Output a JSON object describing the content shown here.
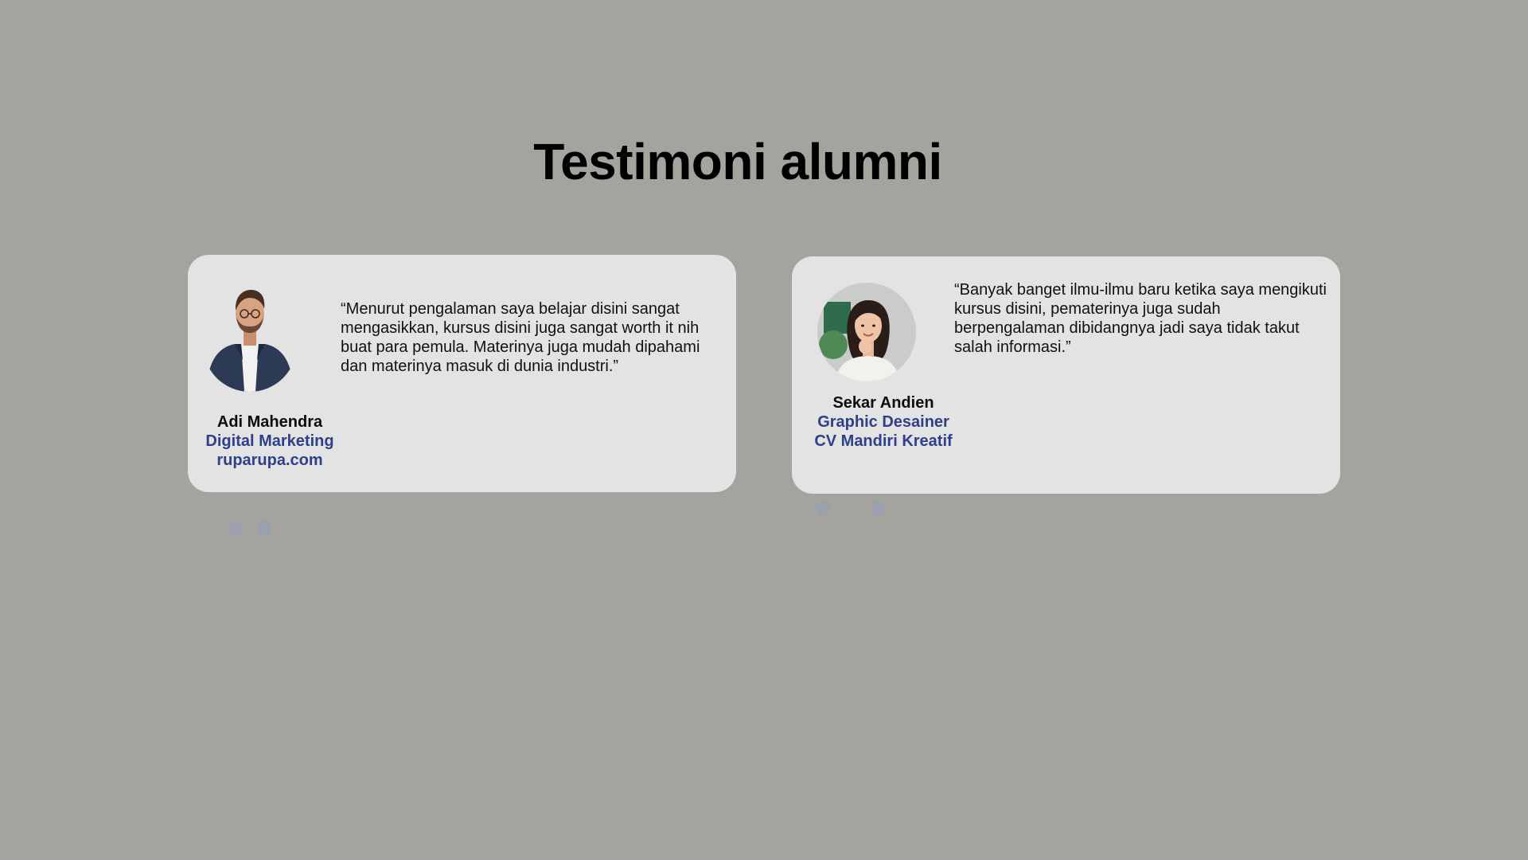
{
  "page": {
    "title": "Testimoni alumni"
  },
  "testimonials": [
    {
      "name": "Adi Mahendra",
      "role": "Digital Marketing",
      "company": "ruparupa.com",
      "quote": "“Menurut pengalaman saya belajar disini sangat mengasikkan, kursus disini juga sangat worth it nih buat para pemula. Materinya juga mudah dipahami dan materinya masuk di dunia industri.”",
      "avatar_icon": "man-portrait-icon"
    },
    {
      "name": "Sekar Andien",
      "role": "Graphic Desainer",
      "company": "CV Mandiri Kreatif",
      "quote": "“Banyak banget ilmu-ilmu baru ketika saya mengikuti kursus disini, pematerinya juga sudah berpengalaman dibidangnya jadi saya tidak takut salah informasi.”",
      "avatar_icon": "woman-portrait-icon"
    }
  ],
  "colors": {
    "background": "#a4a39d",
    "card": "#e3e3e3",
    "accent": "#2e3f8c",
    "dot": "#9aa0ad"
  }
}
